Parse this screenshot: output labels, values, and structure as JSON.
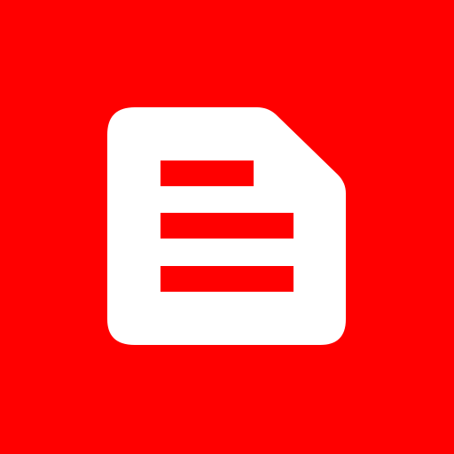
{
  "icon": {
    "name": "document-icon",
    "background_color": "#FF0000",
    "foreground_color": "#FFFFFF",
    "line_color": "#FF0000",
    "text_lines": 3
  }
}
